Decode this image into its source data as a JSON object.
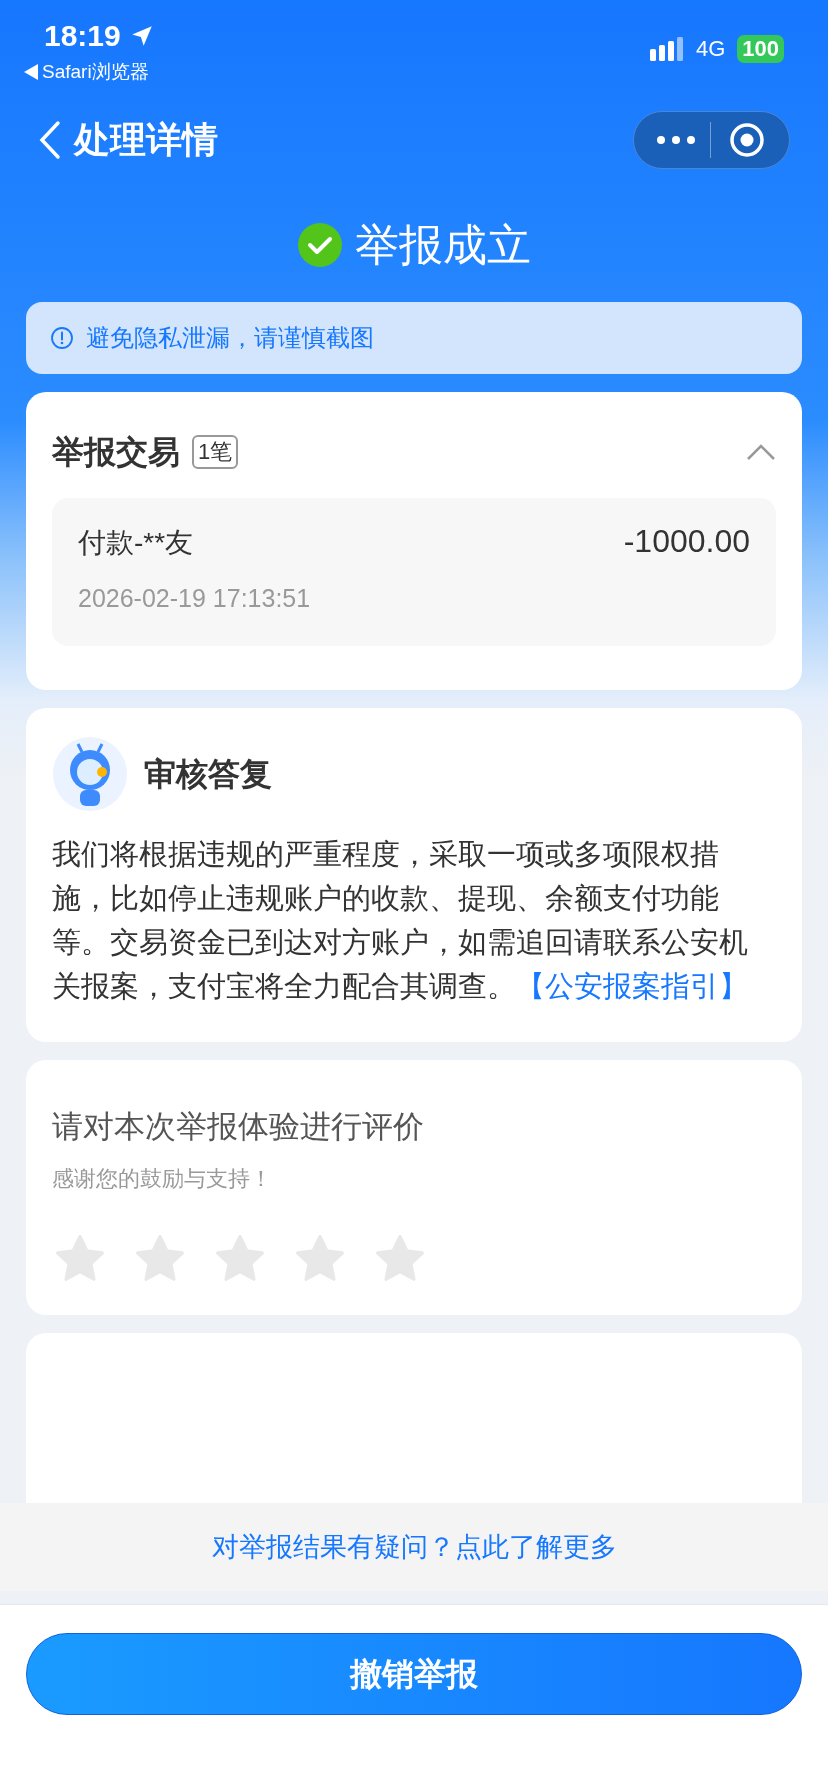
{
  "status_bar": {
    "time": "18:19",
    "back_app": "Safari浏览器",
    "network": "4G",
    "battery": "100"
  },
  "nav": {
    "title": "处理详情"
  },
  "result": {
    "title": "举报成立"
  },
  "notice": {
    "text": "避免隐私泄漏，请谨慎截图"
  },
  "transactions": {
    "title": "举报交易",
    "count": "1笔",
    "expanded": true,
    "items": [
      {
        "name": "付款-**友",
        "amount": "-1000.00",
        "time": "2026-02-19 17:13:51"
      }
    ]
  },
  "reply": {
    "title": "审核答复",
    "text": "我们将根据违规的严重程度，采取一项或多项限权措施，比如停止违规账户的收款、提现、余额支付功能等。交易资金已到达对方账户，如需追回请联系公安机关报案，支付宝将全力配合其调查。",
    "link": "【公安报案指引】"
  },
  "rating": {
    "title": "请对本次举报体验进行评价",
    "subtitle": "感谢您的鼓励与支持！",
    "stars": 0
  },
  "help_link": "对举报结果有疑问？点此了解更多",
  "cancel_button": "撤销举报"
}
